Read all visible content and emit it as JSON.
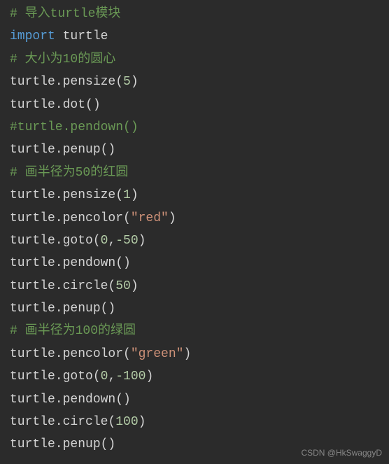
{
  "lines": {
    "l1_comment": "# 导入turtle模块",
    "l2_keyword": "import",
    "l2_module": " turtle",
    "l3_comment": "# 大小为10的圆心",
    "l4_text": "turtle.pensize(",
    "l4_num": "5",
    "l4_close": ")",
    "l5_text": "turtle.dot()",
    "l6_comment": "#turtle.pendown()",
    "l7_text": "turtle.penup()",
    "l8_comment": "# 画半径为50的红圆",
    "l9_text": "turtle.pensize(",
    "l9_num": "1",
    "l9_close": ")",
    "l10_text": "turtle.pencolor(",
    "l10_str": "\"red\"",
    "l10_close": ")",
    "l11_text": "turtle.goto(",
    "l11_num1": "0",
    "l11_comma": ",",
    "l11_num2": "-50",
    "l11_close": ")",
    "l12_text": "turtle.pendown()",
    "l13_text": "turtle.circle(",
    "l13_num": "50",
    "l13_close": ")",
    "l14_text": "turtle.penup()",
    "l15_comment": "# 画半径为100的绿圆",
    "l16_text": "turtle.pencolor(",
    "l16_str": "\"green\"",
    "l16_close": ")",
    "l17_text": "turtle.goto(",
    "l17_num1": "0",
    "l17_comma": ",",
    "l17_num2": "-100",
    "l17_close": ")",
    "l18_text": "turtle.pendown()",
    "l19_text": "turtle.circle(",
    "l19_num": "100",
    "l19_close": ")",
    "l20_text": "turtle.penup()"
  },
  "watermark": "CSDN @HkSwaggyD"
}
